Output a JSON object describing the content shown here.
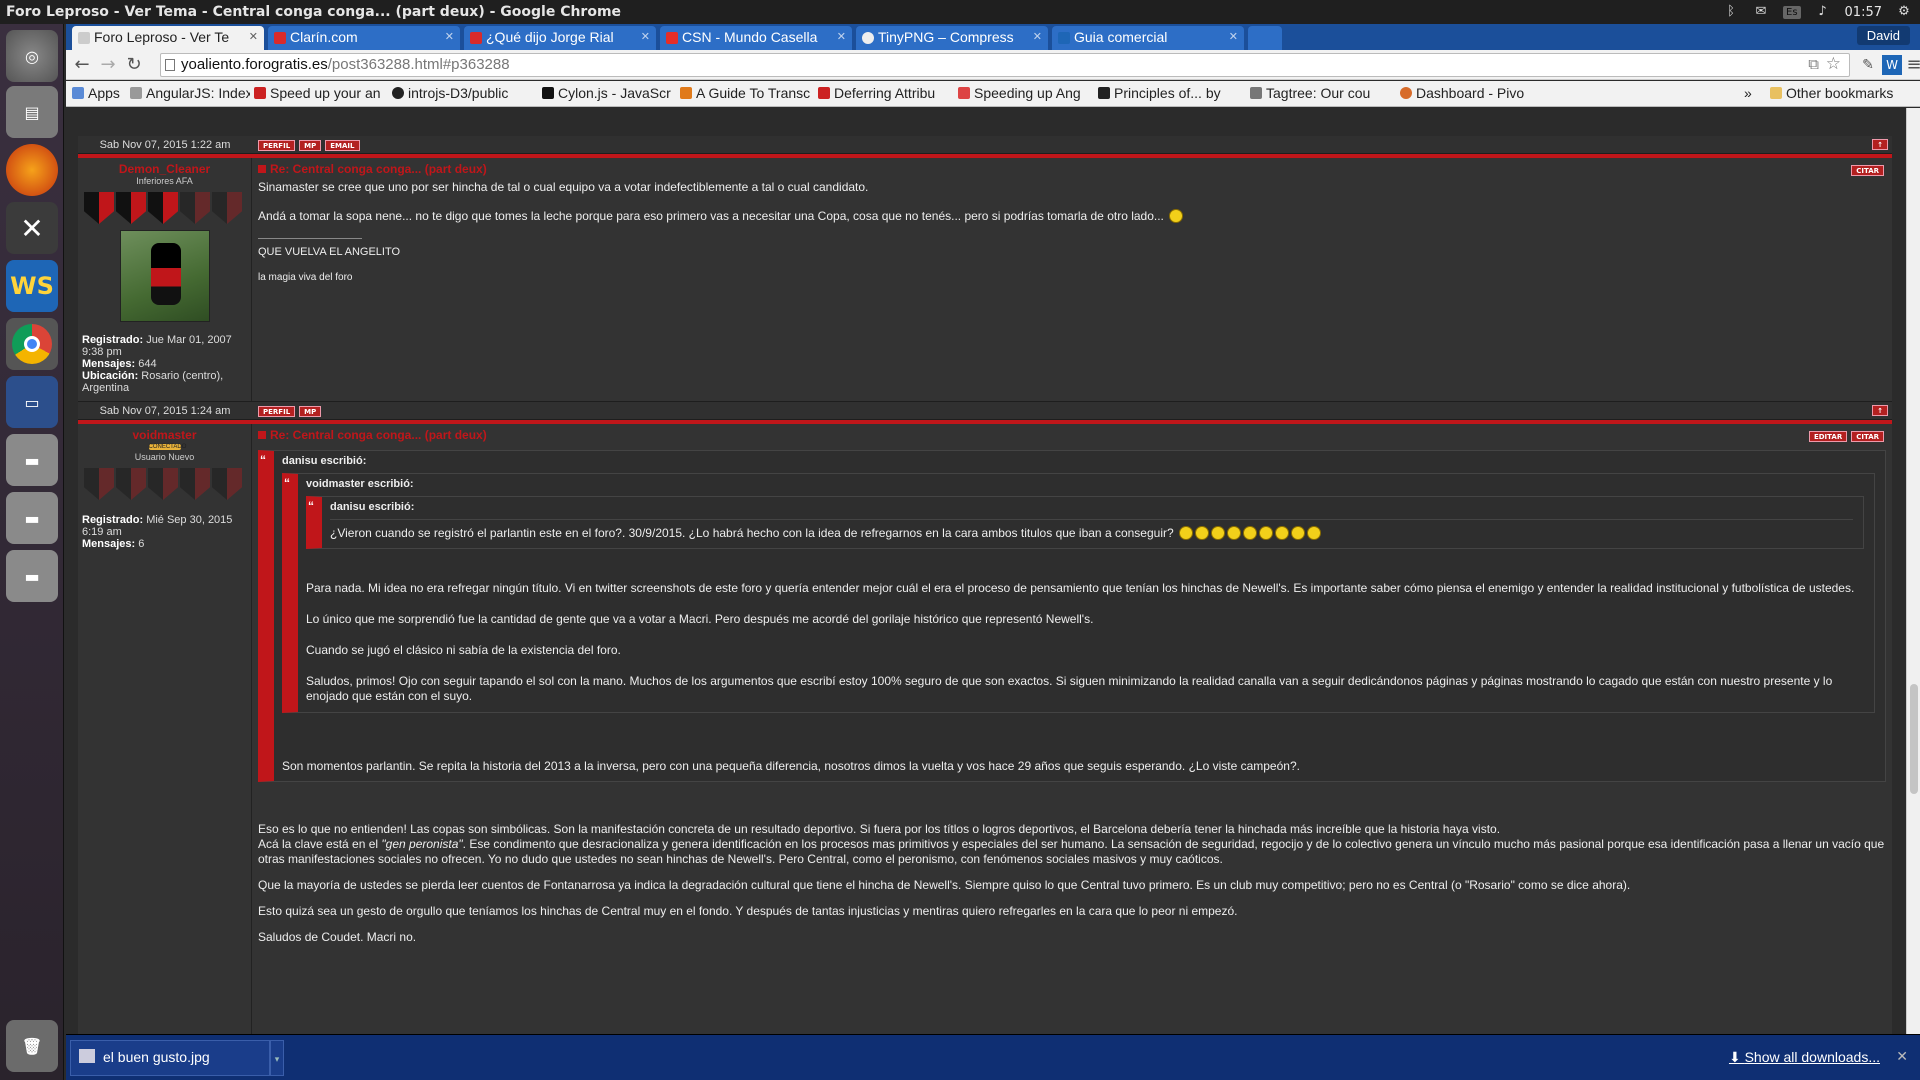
{
  "os": {
    "window_title": "Foro Leproso - Ver Tema - Central conga conga... (part deux) - Google Chrome",
    "keyboard": "Es",
    "clock": "01:57",
    "user": "David"
  },
  "tabs": [
    {
      "label": "Foro Leproso - Ver Te",
      "active": true
    },
    {
      "label": "Clarín.com"
    },
    {
      "label": "¿Qué dijo Jorge Rial"
    },
    {
      "label": "CSN - Mundo Casella"
    },
    {
      "label": "TinyPNG – Compress"
    },
    {
      "label": "Guia comercial"
    }
  ],
  "profile_name": "David",
  "omnibox": {
    "host": "yoaliento.forogratis.es",
    "path": "/post363288.html#p363288"
  },
  "bookmarks": [
    "Apps",
    "AngularJS: Index",
    "Speed up your an",
    "introjs-D3/public",
    "Cylon.js - JavaScr",
    "A Guide To Transc",
    "Deferring Attribu",
    "Speeding up Ang",
    "Principles of... by",
    "Tagtree: Our cou",
    "Dashboard - Pivo"
  ],
  "bookmarks_overflow": "»",
  "other_bookmarks": "Other bookmarks",
  "posts": {
    "row1_date": "Sab Nov 07, 2015 1:22 am",
    "btn_perfil": "PERFIL",
    "btn_mp": "MP",
    "btn_email": "EMAIL",
    "btn_citar": "CITAR",
    "btn_editar": "EDITAR",
    "p1": {
      "username": "Demon_Cleaner",
      "rank": "Inferiores AFA",
      "subject": "Re: Central conga conga... (part deux)",
      "body1": "Sinamaster se cree que uno por ser hincha de tal o cual equipo va a votar indefectiblemente a tal o cual candidato.",
      "body2": "Andá a tomar la sopa nene... no te digo que tomes la leche porque para eso primero vas a necesitar una Copa, cosa que no tenés... pero si podrías tomarla de otro lado...",
      "sig1": "QUE VUELVA EL ANGELITO",
      "sig2": "la magia viva del foro",
      "registered_label": "Registrado:",
      "registered": "Jue Mar 01, 2007 9:38 pm",
      "messages_label": "Mensajes:",
      "messages": "644",
      "location_label": "Ubicación:",
      "location": "Rosario (centro), Argentina"
    },
    "row2_date": "Sab Nov 07, 2015 1:24 am",
    "p2": {
      "username": "voidmaster",
      "online": "CONECTADO",
      "rank": "Usuario Nuevo",
      "subject": "Re: Central conga conga... (part deux)",
      "registered_label": "Registrado:",
      "registered": "Mié Sep 30, 2015 6:19 am",
      "messages_label": "Mensajes:",
      "messages": "6",
      "q1_head": "danisu escribió:",
      "q2_head": "voidmaster escribió:",
      "q3_head": "danisu escribió:",
      "q3_body": "¿Vieron cuando se registró el parlantin este en el foro?. 30/9/2015. ¿Lo habrá hecho con la idea de refregarnos en la cara ambos titulos que iban a conseguir?",
      "q2_p1": "Para nada. Mi idea no era refregar ningún título. Vi en twitter screenshots de este foro y quería entender mejor cuál el era el proceso de pensamiento que tenían los hinchas de Newell's. Es importante saber cómo piensa el enemigo y entender la realidad institucional y futbolística de ustedes.",
      "q2_p2": "Lo único que me sorprendió fue la cantidad de gente que va a votar a Macri. Pero después me acordé del gorilaje histórico que representó Newell's.",
      "q2_p3": "Cuando se jugó el clásico ni sabía de la existencia del foro.",
      "q2_p4": "Saludos, primos! Ojo con seguir tapando el sol con la mano. Muchos de los argumentos que escribí estoy 100% seguro de que son exactos. Si siguen minimizando la realidad canalla van a seguir dedicándonos páginas y páginas mostrando lo cagado que están con nuestro presente y lo enojado que están con el suyo.",
      "q1_body": "Son momentos parlantin. Se repita la historia del 2013 a la inversa, pero con una pequeña diferencia, nosotros dimos la vuelta y vos hace 29 años que seguis esperando. ¿Lo viste campeón?.",
      "b1": "Eso es lo que no entienden! Las copas son simbólicas. Son la manifestación concreta de un resultado deportivo. Si fuera por los títlos o logros deportivos, el Barcelona debería tener la hinchada más increíble que la historia haya visto.",
      "b2a": "Acá la clave está en el ",
      "b2em": "\"gen peronista\"",
      "b2b": ". Ese condimento que desracionaliza y genera identificación en los procesos mas primitivos y especiales del ser humano. La sensación de seguridad, regocijo y de lo colectivo genera un vínculo mucho más pasional porque esa identificación pasa a llenar un vacío que otras manifestaciones sociales no ofrecen. Yo no dudo que ustedes no sean hinchas de Newell's. Pero Central, como el peronismo, con fenómenos sociales masivos y muy caóticos.",
      "b3": "Que la mayoría de ustedes se pierda leer cuentos de Fontanarrosa ya indica la degradación cultural que tiene el hincha de Newell's. Siempre quiso lo que Central tuvo primero. Es un club muy competitivo; pero no es Central (o \"Rosario\" como se dice ahora).",
      "b4": "Esto quizá sea un gesto de orgullo que teníamos los hinchas de Central muy en el fondo. Y después de tantas injusticias y mentiras quiero refregarles en la cara que lo peor ni empezó.",
      "b5": "Saludos de Coudet. Macri no."
    }
  },
  "downloads": {
    "file": "el buen gusto.jpg",
    "show_all": "Show all downloads..."
  },
  "colors": {
    "accent_red": "#c0161a",
    "page_bg": "#2b2b2b",
    "tabstrip": "#1b4f9a"
  }
}
